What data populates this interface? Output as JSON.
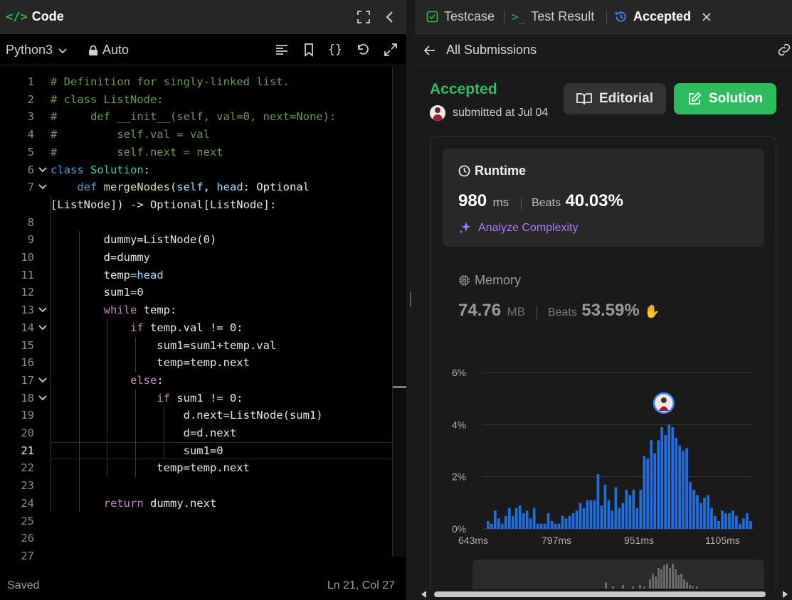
{
  "editor_header": {
    "title": "Code",
    "title_icon": "code-brackets-icon",
    "actions": [
      "fullscreen-icon",
      "collapse-left-icon"
    ]
  },
  "toolbar": {
    "language": "Python3",
    "mode": "Auto",
    "actions": [
      "format-icon",
      "bookmark-icon",
      "braces-icon",
      "reset-icon",
      "expand-icon"
    ]
  },
  "code": {
    "lines": [
      "# Definition for singly-linked list.",
      "# class ListNode:",
      "#     def __init__(self, val=0, next=None):",
      "#         self.val = val",
      "#         self.next = next",
      "class Solution:",
      "    def mergeNodes(self, head: Optional",
      "[ListNode]) -> Optional[ListNode]:",
      "",
      "        dummy=ListNode(0)",
      "        d=dummy",
      "        temp=head",
      "        sum1=0",
      "        while temp:",
      "            if temp.val != 0:",
      "                sum1=sum1+temp.val",
      "                temp=temp.next",
      "            else:",
      "                if sum1 != 0:",
      "                    d.next=ListNode(sum1)",
      "                    d=d.next",
      "                    sum1=0",
      "                temp=temp.next",
      "",
      "        return dummy.next",
      "",
      "",
      ""
    ],
    "line_numbers": [
      "1",
      "2",
      "3",
      "4",
      "5",
      "6",
      "7",
      "",
      "8",
      "9",
      "10",
      "11",
      "12",
      "13",
      "14",
      "15",
      "16",
      "17",
      "18",
      "19",
      "20",
      "21",
      "22",
      "23",
      "24",
      "25",
      "26",
      "27"
    ],
    "current_line": "21"
  },
  "status_bar": {
    "saved": "Saved",
    "cursor": "Ln 21, Col 27"
  },
  "tabs": [
    {
      "label": "Testcase",
      "icon": "checkbox-icon"
    },
    {
      "label": "Test Result",
      "icon": "terminal-icon"
    },
    {
      "label": "Accepted",
      "icon": "history-icon"
    }
  ],
  "submission": {
    "back_label": "All Submissions",
    "status": "Accepted",
    "submitted": "submitted at Jul 04",
    "editorial_label": "Editorial",
    "solution_label": "Solution"
  },
  "runtime": {
    "title": "Runtime",
    "value": "980",
    "unit": "ms",
    "beats_label": "Beats",
    "beats_value": "40.03%",
    "analyze_label": "Analyze Complexity"
  },
  "memory": {
    "title": "Memory",
    "value": "74.76",
    "unit": "MB",
    "beats_label": "Beats",
    "beats_value": "53.59%"
  },
  "colors": {
    "accepted": "#2dbe60",
    "bar": "#1f6fe0",
    "solution_button": "#2cbb5d",
    "analyze": "#a67cff"
  },
  "chart_data": {
    "type": "bar",
    "title": "",
    "xlabel": "",
    "ylabel": "",
    "x_ticks": [
      "643ms",
      "797ms",
      "951ms",
      "1105ms"
    ],
    "y_ticks": [
      "0%",
      "2%",
      "4%",
      "6%"
    ],
    "ylim": [
      0,
      6.5
    ],
    "grid": true,
    "series": [
      {
        "values": [
          0.3,
          0.2,
          0.7,
          0.4,
          0.2,
          0.5,
          0.8,
          0.5,
          0.8,
          0.9,
          0.6,
          0.7,
          0.4,
          0.8,
          0.2,
          0.2,
          0.2,
          0.6,
          0.3,
          0.2,
          0.2,
          0.5,
          0.4,
          0.5,
          0.6,
          0.7,
          1.0,
          0.8,
          1.1,
          1.1,
          1.1,
          2.1,
          0.9,
          1.7,
          1.1,
          0.7,
          1.6,
          0.8,
          1.0,
          1.5,
          1.3,
          1.5,
          0.8,
          1.5,
          2.8,
          2.7,
          3.4,
          2.9,
          3.4,
          3.9,
          3.6,
          4.0,
          3.9,
          3.5,
          3.2,
          3.0,
          3.1,
          1.8,
          1.5,
          1.3,
          1.0,
          1.2,
          1.3,
          0.8,
          0.5,
          0.3,
          0.7,
          0.6,
          0.6,
          0.7,
          0.5,
          0.2,
          0.4,
          0.6,
          0.3
        ]
      }
    ],
    "marker_index": 51
  }
}
